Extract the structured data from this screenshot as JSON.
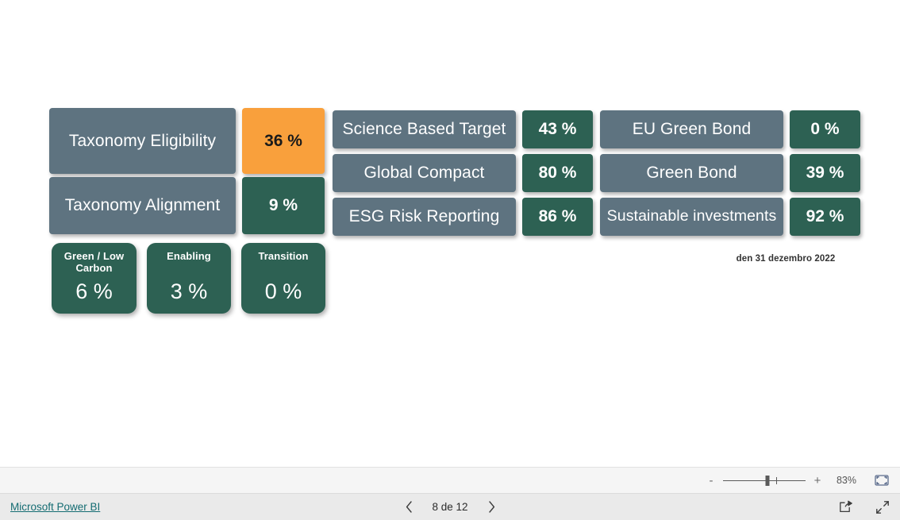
{
  "colors": {
    "slate": "#5e7380",
    "green": "#2d6153",
    "orange": "#f9a03c",
    "canvas": "#ffffff",
    "link": "#146c72"
  },
  "report": {
    "date_caption": "den 31 dezembro 2022",
    "groups": {
      "taxonomy": [
        {
          "label": "Taxonomy Eligibility",
          "value": "36 %",
          "value_style": "orange"
        },
        {
          "label": "Taxonomy Alignment",
          "value": "9 %",
          "value_style": "green"
        }
      ],
      "taxonomy_breakdown": [
        {
          "title": "Green / Low Carbon",
          "value": "6 %"
        },
        {
          "title": "Enabling",
          "value": "3 %"
        },
        {
          "title": "Transition",
          "value": "0 %"
        }
      ],
      "commitments": [
        {
          "label": "Science Based Target",
          "value": "43 %"
        },
        {
          "label": "Global Compact",
          "value": "80 %"
        },
        {
          "label": "ESG Risk Reporting",
          "value": "86 %"
        }
      ],
      "bonds": [
        {
          "label": "EU Green Bond",
          "value": "0 %"
        },
        {
          "label": "Green Bond",
          "value": "39 %"
        },
        {
          "label": "Sustainable investments",
          "value": "92 %"
        }
      ]
    }
  },
  "zoom_bar": {
    "decrease_label": "-",
    "increase_label": "+",
    "percent": "83%",
    "fit_icon": "fit-to-page-icon"
  },
  "footer": {
    "brand": "Microsoft Power BI",
    "page_label": "8 de 12",
    "prev_icon": "chevron-left-icon",
    "next_icon": "chevron-right-icon",
    "share_icon": "share-icon",
    "fullscreen_icon": "fullscreen-icon"
  }
}
